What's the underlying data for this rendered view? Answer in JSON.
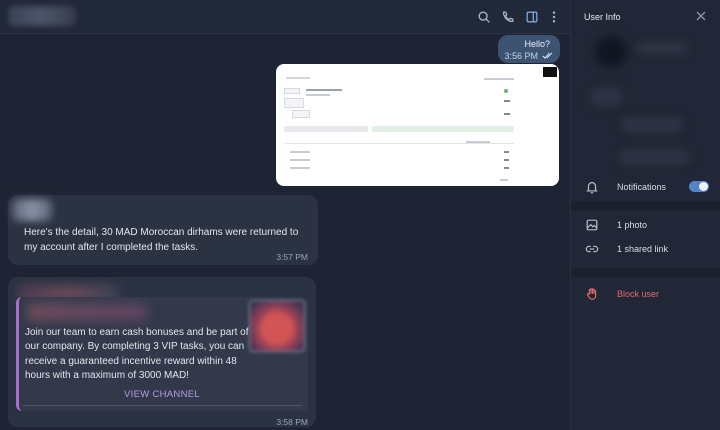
{
  "chat": {
    "header_icons": [
      "search-icon",
      "phone-icon",
      "sidebar-toggle-icon",
      "more-vertical-icon"
    ],
    "messages": {
      "hello": {
        "text": "Hello?",
        "time": "3:56 PM"
      },
      "detail": {
        "text": "Here's the detail, 30 MAD Moroccan dirhams were returned to my account after I completed the tasks.",
        "time": "3:57 PM"
      },
      "channel": {
        "preview_text": "Join our team to earn cash bonuses and be part of our company. By completing 3 VIP tasks, you can receive a guaranteed incentive reward within 48 hours with a maximum of 3000 MAD!",
        "button": "VIEW CHANNEL",
        "time": "3:58 PM"
      }
    }
  },
  "info": {
    "title": "User Info",
    "notifications": "Notifications",
    "notifications_on": true,
    "photos": "1 photo",
    "links": "1 shared link",
    "block": "Block user"
  },
  "colors": {
    "accent": "#5682c8",
    "outgoing_bubble": "#3d5372",
    "danger": "#e06a6a",
    "channel_link": "#b49be0"
  }
}
